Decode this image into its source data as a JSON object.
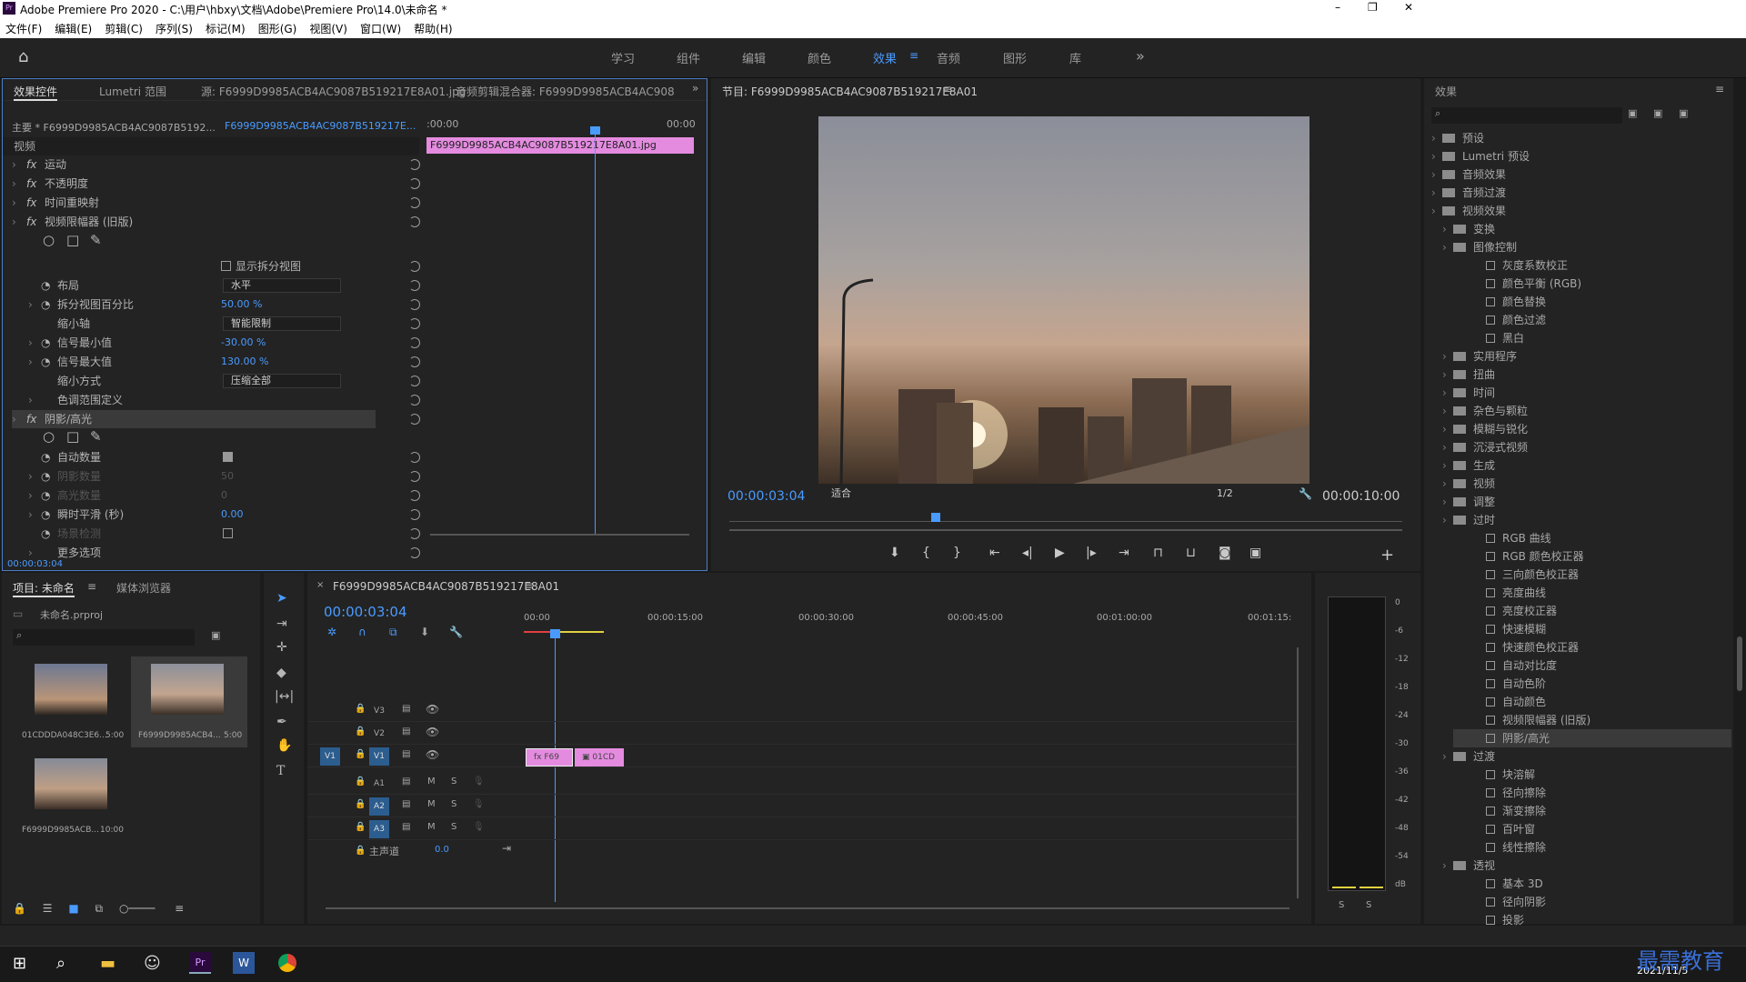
{
  "window": {
    "title": "Adobe Premiere Pro 2020 - C:\\用户\\hbxy\\文档\\Adobe\\Premiere Pro\\14.0\\未命名 *",
    "app_icon": "Pr",
    "controls": [
      "–",
      "❐",
      "✕"
    ]
  },
  "menu": [
    "文件(F)",
    "编辑(E)",
    "剪辑(C)",
    "序列(S)",
    "标记(M)",
    "图形(G)",
    "视图(V)",
    "窗口(W)",
    "帮助(H)"
  ],
  "workspaces": [
    "学习",
    "组件",
    "编辑",
    "颜色",
    "效果",
    "音频",
    "图形",
    "库"
  ],
  "active_workspace": "效果",
  "effect_controls": {
    "tabs": [
      "效果控件",
      "Lumetri 范围",
      "源: F6999D9985ACB4AC9087B519217E8A01.jpg",
      "音频剪辑混合器: F6999D9985ACB4AC9087B5"
    ],
    "master": "主要 * F6999D9985ACB4AC9087B5192...",
    "clip": "F6999D9985ACB4AC9087B519217E...",
    "section": "视频",
    "rows": [
      {
        "label": "运动"
      },
      {
        "label": "不透明度"
      },
      {
        "label": "时间重映射"
      },
      {
        "label": "视频限幅器 (旧版)"
      },
      {
        "label": "显示拆分视图"
      },
      {
        "label": "布局",
        "value": "水平"
      },
      {
        "label": "拆分视图百分比",
        "value": "50.00 %"
      },
      {
        "label": "缩小轴",
        "value": "智能限制"
      },
      {
        "label": "信号最小值",
        "value": "-30.00 %"
      },
      {
        "label": "信号最大值",
        "value": "130.00 %"
      },
      {
        "label": "缩小方式",
        "value": "压缩全部"
      },
      {
        "label": "色调范围定义"
      },
      {
        "label": "阴影/高光"
      },
      {
        "label": "自动数量"
      },
      {
        "label": "阴影数量",
        "value": "50"
      },
      {
        "label": "高光数量",
        "value": "0"
      },
      {
        "label": "瞬时平滑 (秒)",
        "value": "0.00"
      },
      {
        "label": "场景检测"
      },
      {
        "label": "更多选项"
      }
    ],
    "timeline_start": ":00:00",
    "timeline_end": "00:00",
    "clip_bar": "F6999D9985ACB4AC9087B519217E8A01.jpg",
    "timecode": "00:00:03:04"
  },
  "program": {
    "title": "节目: F6999D9985ACB4AC9087B519217E8A01",
    "timecode": "00:00:03:04",
    "fit": "适合",
    "resolution": "1/2",
    "duration": "00:00:10:00"
  },
  "effects": {
    "title": "效果",
    "items": [
      {
        "label": "预设",
        "level": 0,
        "type": "folder"
      },
      {
        "label": "Lumetri 预设",
        "level": 0,
        "type": "folder"
      },
      {
        "label": "音频效果",
        "level": 0,
        "type": "folder"
      },
      {
        "label": "音频过渡",
        "level": 0,
        "type": "folder"
      },
      {
        "label": "视频效果",
        "level": 0,
        "type": "folder"
      },
      {
        "label": "变换",
        "level": 1,
        "type": "folder"
      },
      {
        "label": "图像控制",
        "level": 1,
        "type": "folder"
      },
      {
        "label": "灰度系数校正",
        "level": 2,
        "type": "fx"
      },
      {
        "label": "颜色平衡 (RGB)",
        "level": 2,
        "type": "fx"
      },
      {
        "label": "颜色替换",
        "level": 2,
        "type": "fx"
      },
      {
        "label": "颜色过滤",
        "level": 2,
        "type": "fx"
      },
      {
        "label": "黑白",
        "level": 2,
        "type": "fx"
      },
      {
        "label": "实用程序",
        "level": 1,
        "type": "folder"
      },
      {
        "label": "扭曲",
        "level": 1,
        "type": "folder"
      },
      {
        "label": "时间",
        "level": 1,
        "type": "folder"
      },
      {
        "label": "杂色与颗粒",
        "level": 1,
        "type": "folder"
      },
      {
        "label": "模糊与锐化",
        "level": 1,
        "type": "folder"
      },
      {
        "label": "沉浸式视频",
        "level": 1,
        "type": "folder"
      },
      {
        "label": "生成",
        "level": 1,
        "type": "folder"
      },
      {
        "label": "视频",
        "level": 1,
        "type": "folder"
      },
      {
        "label": "调整",
        "level": 1,
        "type": "folder"
      },
      {
        "label": "过时",
        "level": 1,
        "type": "folder"
      },
      {
        "label": "RGB 曲线",
        "level": 2,
        "type": "fx"
      },
      {
        "label": "RGB 颜色校正器",
        "level": 2,
        "type": "fx"
      },
      {
        "label": "三向颜色校正器",
        "level": 2,
        "type": "fx"
      },
      {
        "label": "亮度曲线",
        "level": 2,
        "type": "fx"
      },
      {
        "label": "亮度校正器",
        "level": 2,
        "type": "fx"
      },
      {
        "label": "快速模糊",
        "level": 2,
        "type": "fx"
      },
      {
        "label": "快速颜色校正器",
        "level": 2,
        "type": "fx"
      },
      {
        "label": "自动对比度",
        "level": 2,
        "type": "fx"
      },
      {
        "label": "自动色阶",
        "level": 2,
        "type": "fx"
      },
      {
        "label": "自动颜色",
        "level": 2,
        "type": "fx"
      },
      {
        "label": "视频限幅器 (旧版)",
        "level": 2,
        "type": "fx"
      },
      {
        "label": "阴影/高光",
        "level": 2,
        "type": "fx",
        "selected": true
      },
      {
        "label": "过渡",
        "level": 1,
        "type": "folder"
      },
      {
        "label": "块溶解",
        "level": 2,
        "type": "fx"
      },
      {
        "label": "径向擦除",
        "level": 2,
        "type": "fx"
      },
      {
        "label": "渐变擦除",
        "level": 2,
        "type": "fx"
      },
      {
        "label": "百叶窗",
        "level": 2,
        "type": "fx"
      },
      {
        "label": "线性擦除",
        "level": 2,
        "type": "fx"
      },
      {
        "label": "透视",
        "level": 1,
        "type": "folder"
      },
      {
        "label": "基本 3D",
        "level": 2,
        "type": "fx"
      },
      {
        "label": "径向阴影",
        "level": 2,
        "type": "fx"
      },
      {
        "label": "投影",
        "level": 2,
        "type": "fx"
      }
    ]
  },
  "project": {
    "tabs": [
      "项目: 未命名",
      "媒体浏览器"
    ],
    "file": "未命名.prproj",
    "items": [
      {
        "name": "01CDDDA048C3E6...",
        "dur": "5:00"
      },
      {
        "name": "F6999D9985ACB4...",
        "dur": "5:00"
      },
      {
        "name": "F6999D9985ACB...",
        "dur": "10:00"
      }
    ]
  },
  "sequence": {
    "title": "F6999D9985ACB4AC9087B519217E8A01",
    "timecode": "00:00:03:04",
    "ruler": [
      "00:00",
      "00:00:15:00",
      "00:00:30:00",
      "00:00:45:00",
      "00:01:00:00",
      "00:01:15:"
    ],
    "video_tracks": [
      "V3",
      "V2",
      "V1"
    ],
    "audio_tracks": [
      "A1",
      "A2",
      "A3"
    ],
    "master": "主声道",
    "master_val": "0.0",
    "clips": [
      "F69",
      "01CD"
    ]
  },
  "meter": {
    "scale": [
      "0",
      "-6",
      "-12",
      "-18",
      "-24",
      "-30",
      "-36",
      "-42",
      "-48",
      "-54",
      "dB"
    ]
  },
  "taskbar": {
    "date": "2021/11/5",
    "watermark": "最需教育"
  }
}
